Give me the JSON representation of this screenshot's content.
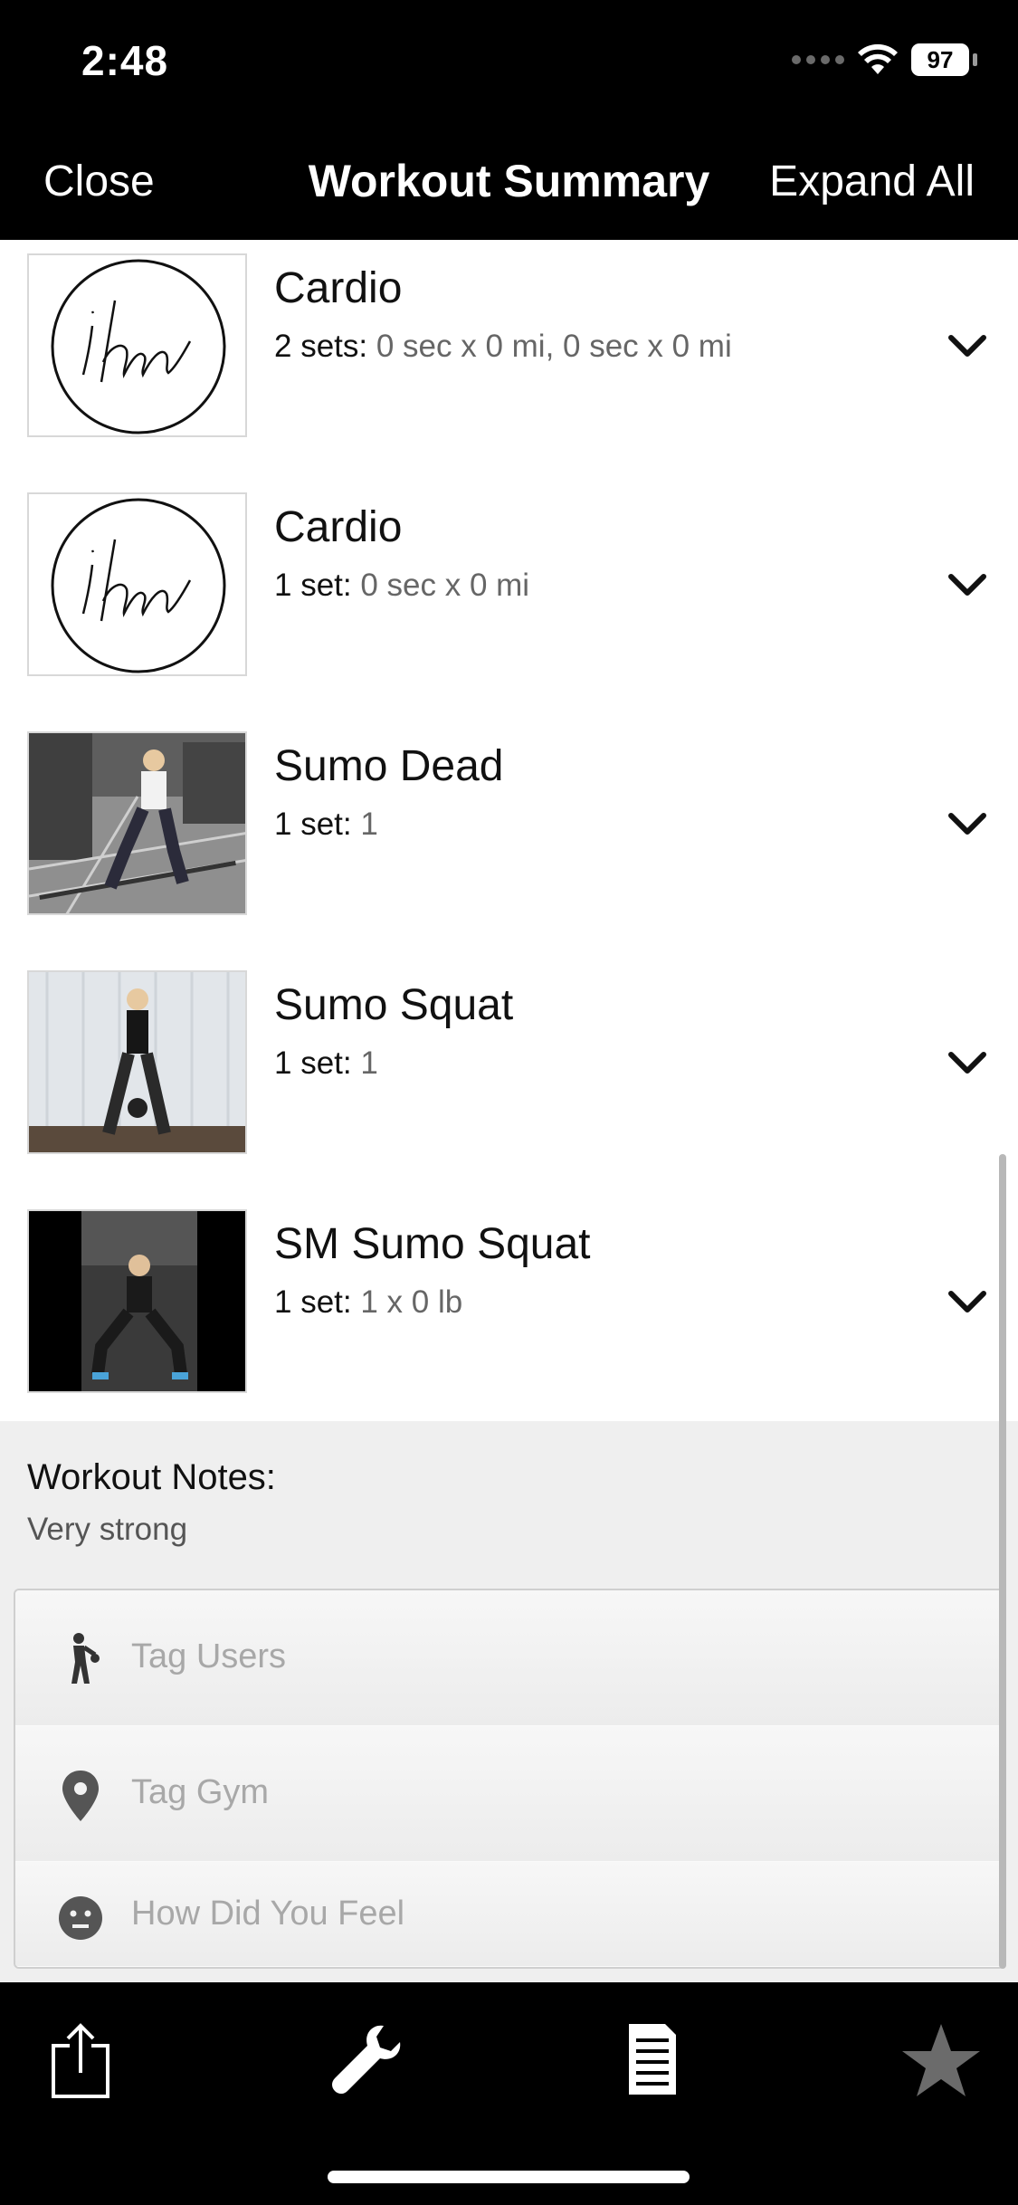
{
  "status_bar": {
    "time": "2:48",
    "battery": "97"
  },
  "nav": {
    "close_label": "Close",
    "title": "Workout Summary",
    "expand_label": "Expand All"
  },
  "exercises": [
    {
      "name": "Cardio",
      "sets_label": "2 sets:",
      "sets_detail": "0 sec x 0 mi, 0 sec x 0 mi",
      "thumb": "ihm-logo"
    },
    {
      "name": "Cardio",
      "sets_label": "1 set:",
      "sets_detail": "0 sec x 0 mi",
      "thumb": "ihm-logo"
    },
    {
      "name": "Sumo Dead",
      "sets_label": "1 set:",
      "sets_detail": "1",
      "thumb": "gym-photo"
    },
    {
      "name": "Sumo Squat",
      "sets_label": "1 set:",
      "sets_detail": "1",
      "thumb": "studio-photo"
    },
    {
      "name": "SM Sumo Squat",
      "sets_label": "1 set:",
      "sets_detail": "1 x 0 lb",
      "thumb": "dark-gym-photo"
    }
  ],
  "notes": {
    "title": "Workout Notes:",
    "text": "Very strong"
  },
  "tags": {
    "users_placeholder": "Tag Users",
    "gym_placeholder": "Tag Gym",
    "feel_placeholder": "How Did You Feel"
  },
  "toolbar": {
    "icons": [
      "share-icon",
      "wrench-icon",
      "list-icon",
      "star-icon"
    ]
  }
}
